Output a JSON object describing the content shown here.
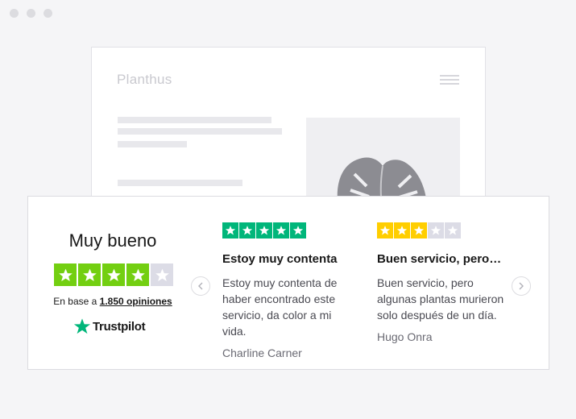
{
  "mock_site": {
    "logo": "Planthus"
  },
  "summary": {
    "title": "Muy bueno",
    "rating_stars": 4,
    "based_on_prefix": "En base a ",
    "based_on_count": "1.850 opiniones",
    "brand": "Trustpilot"
  },
  "colors": {
    "green": "#00b67a",
    "four_star_green": "#73cf11",
    "yellow": "#ffce00",
    "empty": "#dcdce6"
  },
  "reviews": [
    {
      "stars": 5,
      "title": "Estoy muy contenta",
      "body": "Estoy muy contenta de haber encontrado este servicio, da color a mi vida.",
      "author": "Charline Carner"
    },
    {
      "stars": 3,
      "title": "Buen servicio, pero…",
      "body": "Buen servicio, pero algunas plantas murieron solo después de un día.",
      "author": "Hugo Onra"
    }
  ],
  "navigation": {
    "prev_icon": "chevron-left-icon",
    "next_icon": "chevron-right-icon"
  }
}
